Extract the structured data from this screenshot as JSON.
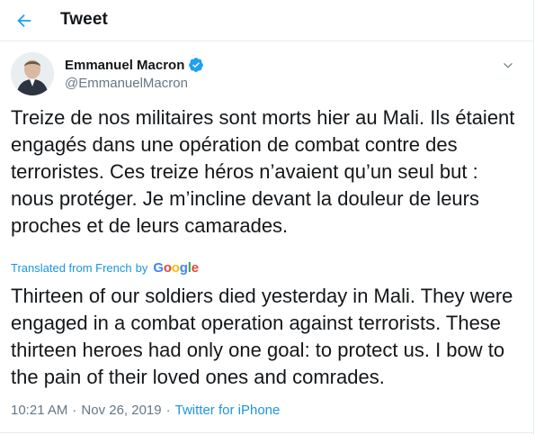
{
  "header": {
    "title": "Tweet",
    "back_icon": "arrow-left-icon"
  },
  "colors": {
    "accent": "#1da1f2",
    "text": "#14171a",
    "muted": "#657786",
    "link": "#1b95e0"
  },
  "author": {
    "name": "Emmanuel Macron",
    "handle": "@EmmanuelMacron",
    "verified": true
  },
  "tweet": {
    "text": "Treize de nos militaires sont morts hier au Mali. Ils étaient engagés dans une opération de combat contre des terroristes. Ces treize héros n’avaient qu’un seul but : nous protéger. Je m’incline devant la douleur de leurs proches et de leurs camarades.",
    "translated_label": "Translated from French",
    "by_label": "by",
    "translation_provider": "Google",
    "translation": "Thirteen of our soldiers died yesterday in Mali. They were engaged in a combat operation against terrorists. These thirteen heroes had only one goal: to protect us. I bow to the pain of their loved ones and comrades.",
    "time": "10:21 AM",
    "separator": "·",
    "date": "Nov 26, 2019",
    "source": "Twitter for iPhone"
  }
}
